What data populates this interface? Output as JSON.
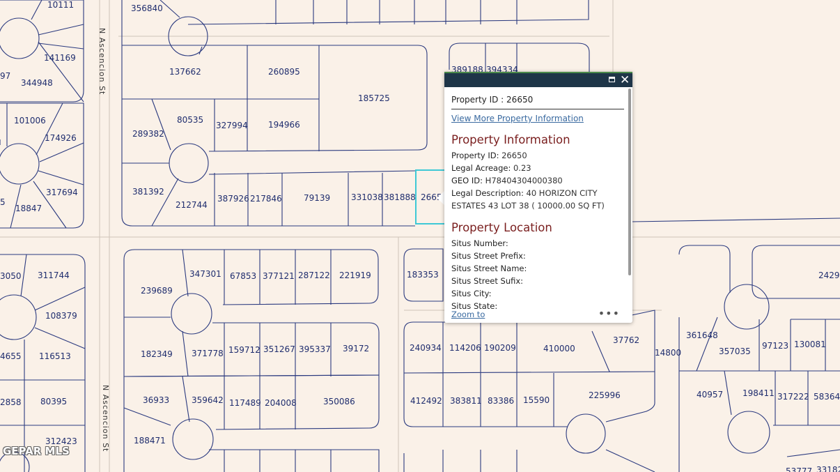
{
  "map": {
    "streets": [
      "N Ascencion St",
      "N Ascencion St"
    ],
    "parcels": [
      "10111",
      "356840",
      "141169",
      "344948",
      "101006",
      "174926",
      "317694",
      "18847",
      "137662",
      "260895",
      "185725",
      "289382",
      "80535",
      "327994",
      "194966",
      "381392",
      "212744",
      "387926",
      "217846",
      "79139",
      "331038",
      "381888",
      "2665",
      "389188",
      "394334",
      "311744",
      "108379",
      "116513",
      "80395",
      "312423",
      "239689",
      "347301",
      "67853",
      "377121",
      "287122",
      "221919",
      "183353",
      "182349",
      "371778",
      "159712",
      "351267",
      "395337",
      "39172",
      "36933",
      "359642",
      "117489",
      "204008",
      "350086",
      "188471",
      "240934",
      "114206",
      "190209",
      "410000",
      "37762",
      "14800",
      "412492",
      "383811",
      "83386",
      "15590",
      "225996",
      "2429",
      "361648",
      "357035",
      "97123",
      "130081",
      "40957",
      "198411",
      "317222",
      "58364",
      "53777",
      "33182",
      "97",
      "3050",
      "4655",
      "2858",
      "5"
    ],
    "selected_parcel_color": "#3ec9d6",
    "lot_line_color": "#2b3a7f",
    "background_color": "#faf1e8"
  },
  "watermark": "GEPAR MLS",
  "popup": {
    "maximize_icon": "maximize-icon",
    "close_icon": "close-icon",
    "property_id_title": "Property ID : 26650",
    "view_more_link": "View More Property Information",
    "info_section_title": "Property Information",
    "info_rows": [
      {
        "label": "Property ID:",
        "value": "26650"
      },
      {
        "label": "Legal Acreage:",
        "value": "0.23"
      },
      {
        "label": "GEO ID:",
        "value": "H78404304000380"
      },
      {
        "label": "Legal Description:",
        "value": "40 HORIZON CITY"
      },
      {
        "label": "",
        "value": "ESTATES 43 LOT 38 ( 10000.00 SQ FT)"
      }
    ],
    "location_section_title": "Property Location",
    "location_rows": [
      {
        "label": "Situs Number:",
        "value": ""
      },
      {
        "label": "Situs Street Prefix:",
        "value": ""
      },
      {
        "label": "Situs Street Name:",
        "value": ""
      },
      {
        "label": "Situs Street Sufix:",
        "value": ""
      },
      {
        "label": "Situs City:",
        "value": ""
      },
      {
        "label": "Situs State:",
        "value": ""
      }
    ],
    "zoom_link": "Zoom to",
    "more_icon": "ellipsis-icon",
    "more_label": "•••",
    "header_color": "#1e3548",
    "section_title_color": "#7a1f1f"
  }
}
